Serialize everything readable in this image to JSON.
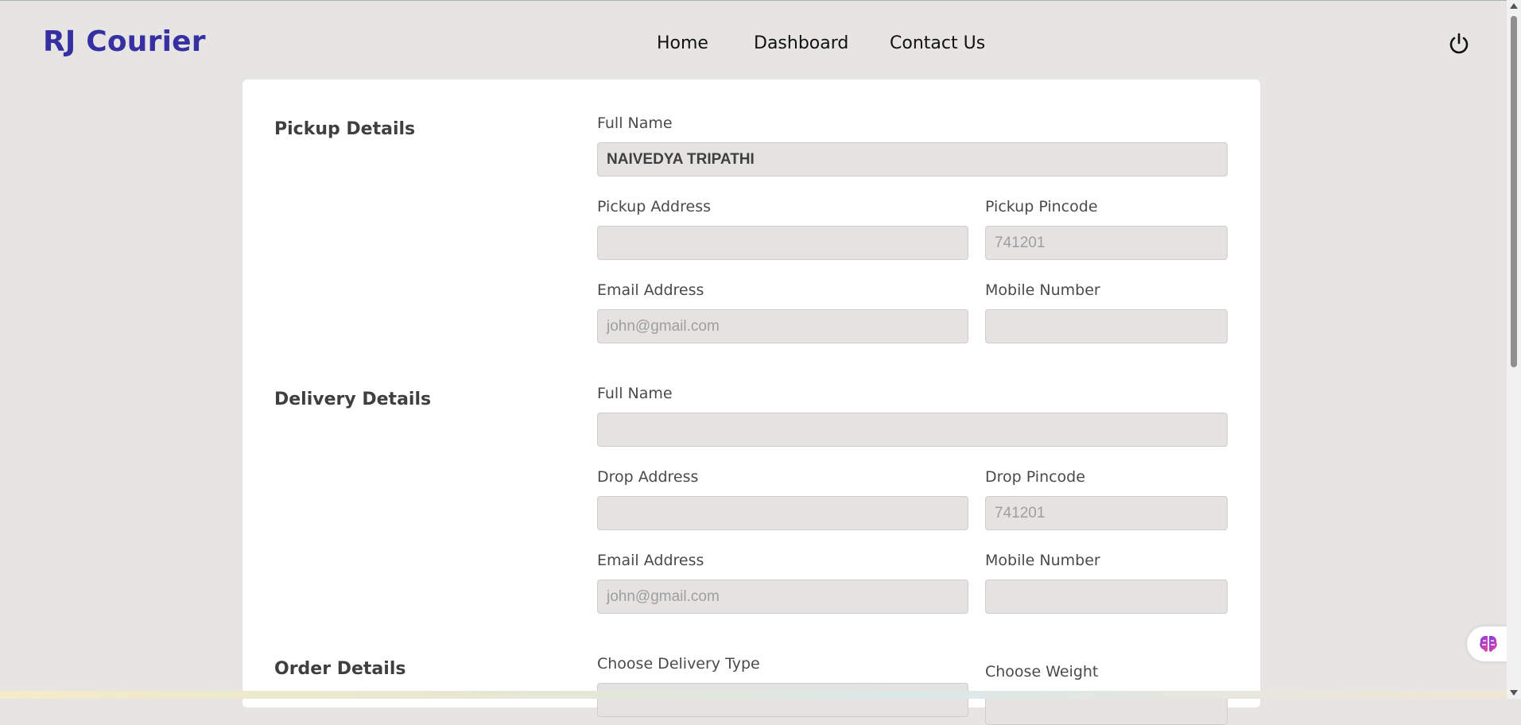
{
  "header": {
    "brand": "RJ Courier",
    "nav": [
      {
        "label": "Home"
      },
      {
        "label": "Dashboard"
      },
      {
        "label": "Contact Us"
      }
    ],
    "power_icon": "power-icon"
  },
  "pickup": {
    "title": "Pickup Details",
    "full_name_label": "Full Name",
    "full_name_value": "NAIVEDYA TRIPATHI",
    "address_label": "Pickup Address",
    "address_value": "",
    "pincode_label": "Pickup Pincode",
    "pincode_placeholder": "741201",
    "email_label": "Email Address",
    "email_placeholder": "john@gmail.com",
    "mobile_label": "Mobile Number",
    "mobile_value": ""
  },
  "delivery": {
    "title": "Delivery Details",
    "full_name_label": "Full Name",
    "full_name_value": "",
    "address_label": "Drop Address",
    "address_value": "",
    "pincode_label": "Drop Pincode",
    "pincode_placeholder": "741201",
    "email_label": "Email Address",
    "email_placeholder": "john@gmail.com",
    "mobile_label": "Mobile Number",
    "mobile_value": ""
  },
  "order": {
    "title": "Order Details",
    "delivery_type_label": "Choose Delivery Type",
    "weight_label": "Choose Weight"
  },
  "colors": {
    "brand": "#3730a3",
    "page_bg": "#e7e5e4",
    "input_bg": "#e5e3e2"
  }
}
